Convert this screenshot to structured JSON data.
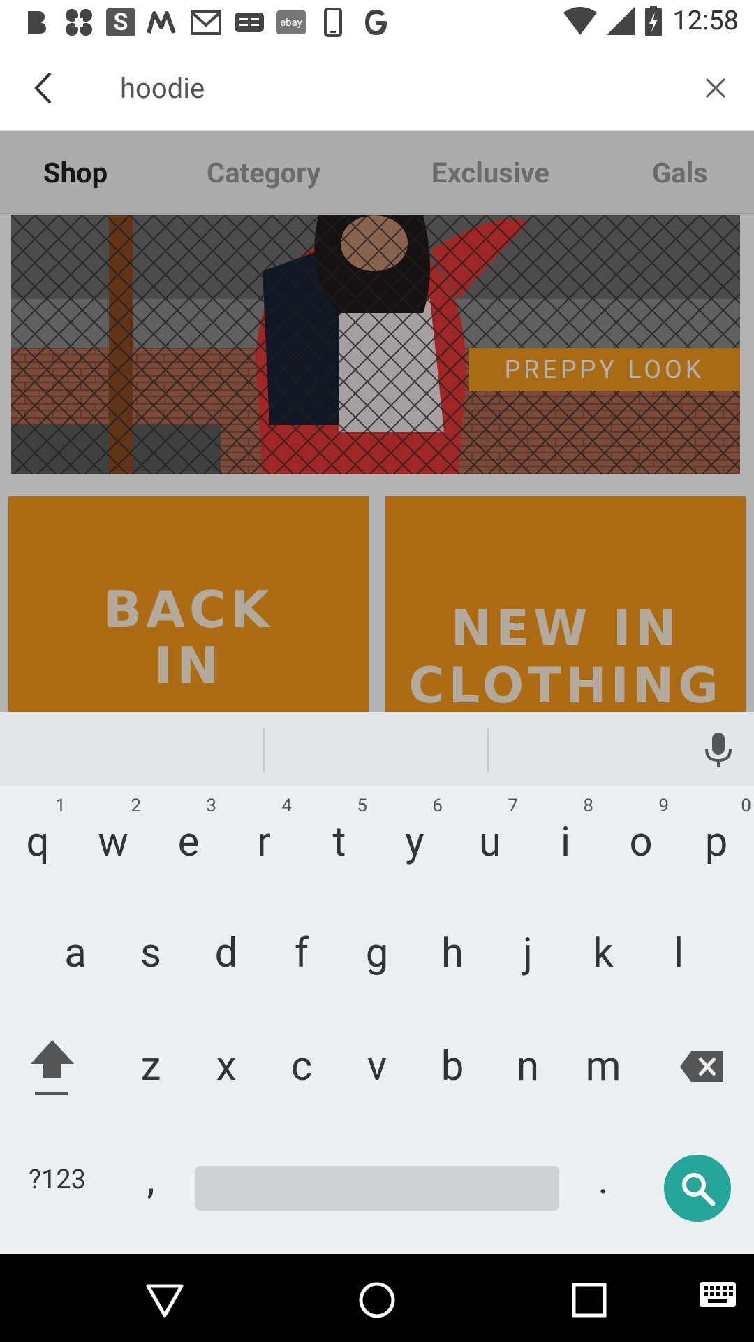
{
  "status_bar": {
    "left_icons": [
      "b-icon",
      "app-icon",
      "s-icon",
      "m-icon",
      "gmail-icon",
      "ge-icon",
      "ebay-icon",
      "phone-icon",
      "google-icon"
    ],
    "ebay_label": "ebay",
    "clock": "12:58"
  },
  "search": {
    "query": "hoodie"
  },
  "tabs": [
    "Shop",
    "Category",
    "Exclusive",
    "Gals"
  ],
  "banner": {
    "label": "PREPPY LOOK"
  },
  "tiles": {
    "left_line1": "BACK",
    "left_line2": "IN",
    "right_line1": "NEW IN",
    "right_line2": "CLOTHING"
  },
  "keyboard": {
    "row1": [
      {
        "k": "q",
        "h": "1"
      },
      {
        "k": "w",
        "h": "2"
      },
      {
        "k": "e",
        "h": "3"
      },
      {
        "k": "r",
        "h": "4"
      },
      {
        "k": "t",
        "h": "5"
      },
      {
        "k": "y",
        "h": "6"
      },
      {
        "k": "u",
        "h": "7"
      },
      {
        "k": "i",
        "h": "8"
      },
      {
        "k": "o",
        "h": "9"
      },
      {
        "k": "p",
        "h": "0"
      }
    ],
    "row2": [
      "a",
      "s",
      "d",
      "f",
      "g",
      "h",
      "j",
      "k",
      "l"
    ],
    "row3": [
      "z",
      "x",
      "c",
      "v",
      "b",
      "n",
      "m"
    ],
    "symbols_label": "?123",
    "comma": ",",
    "period": "."
  },
  "colors": {
    "accent": "#26a69a",
    "banner_tag": "#f39a1d",
    "tile": "#f89a1c"
  }
}
